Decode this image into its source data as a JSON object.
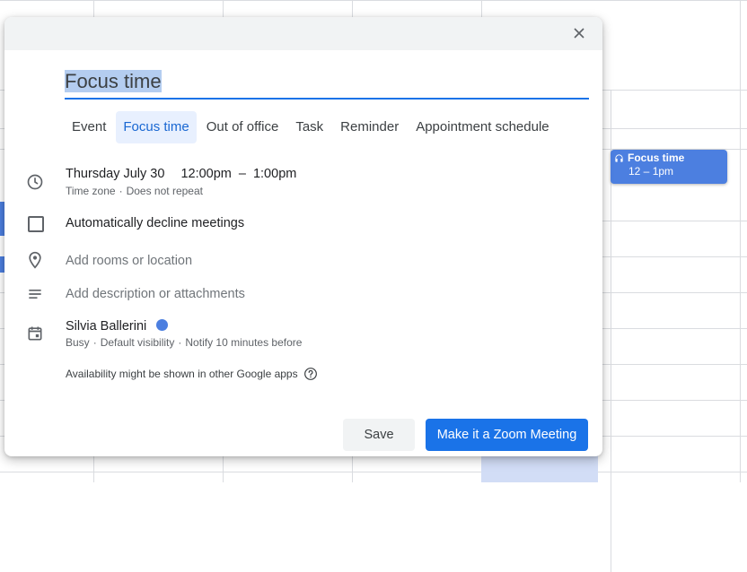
{
  "dialog": {
    "title_value": "Focus time",
    "close_label": "×"
  },
  "tabs": [
    {
      "label": "Event"
    },
    {
      "label": "Focus time"
    },
    {
      "label": "Out of office"
    },
    {
      "label": "Task"
    },
    {
      "label": "Reminder"
    },
    {
      "label": "Appointment schedule"
    }
  ],
  "active_tab": "Focus time",
  "datetime": {
    "date": "Thursday July 30",
    "start": "12:00pm",
    "separator": "–",
    "end": "1:00pm",
    "timezone": "Time zone",
    "sub_separator": "·",
    "repeat": "Does not repeat"
  },
  "auto_decline": {
    "label": "Automatically decline meetings",
    "checked": false
  },
  "location": {
    "placeholder": "Add rooms or location"
  },
  "description": {
    "placeholder": "Add description or attachments"
  },
  "calendar": {
    "owner": "Silvia Ballerini",
    "color": "#4c7fe0",
    "status": "Busy",
    "visibility": "Default visibility",
    "notify": "Notify 10 minutes before",
    "sub_separator": "·"
  },
  "availability_note": "Availability might be shown in other Google apps",
  "buttons": {
    "save": "Save",
    "zoom": "Make it a Zoom Meeting"
  },
  "background_event": {
    "title": "Focus time",
    "time": "12 – 1pm",
    "color": "#4c7fe0"
  },
  "colors": {
    "accent": "#1a73e8",
    "active_tab_bg": "#e8f0fe",
    "header_bg": "#f1f3f4"
  }
}
